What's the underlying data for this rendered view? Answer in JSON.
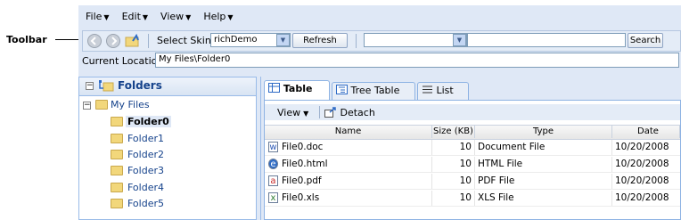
{
  "callout": {
    "label": "Toolbar"
  },
  "menu": [
    {
      "label": "File"
    },
    {
      "label": "Edit"
    },
    {
      "label": "View"
    },
    {
      "label": "Help"
    }
  ],
  "toolbar": {
    "select_skin_label": "Select Skin",
    "skin_value": "richDemo",
    "refresh_label": "Refresh",
    "search_combo_value": "",
    "search_value": "",
    "search_label": "Search"
  },
  "location": {
    "label": "Current Location:",
    "value": "My Files\\Folder0"
  },
  "tree": {
    "title": "Folders",
    "root": "My Files",
    "folders": [
      "Folder0",
      "Folder1",
      "Folder2",
      "Folder3",
      "Folder4",
      "Folder5"
    ],
    "selected": "Folder0"
  },
  "tabs": [
    {
      "label": "Table",
      "active": true
    },
    {
      "label": "Tree Table",
      "active": false
    },
    {
      "label": "List",
      "active": false
    }
  ],
  "grid_toolbar": {
    "view_label": "View",
    "detach_label": "Detach"
  },
  "table": {
    "columns": [
      "Name",
      "Size (KB)",
      "Type",
      "Date"
    ],
    "rows": [
      {
        "name": "File0.doc",
        "size": "10",
        "type": "Document File",
        "date": "10/20/2008",
        "icon": "word-doc-icon"
      },
      {
        "name": "File0.html",
        "size": "10",
        "type": "HTML File",
        "date": "10/20/2008",
        "icon": "html-file-icon"
      },
      {
        "name": "File0.pdf",
        "size": "10",
        "type": "PDF File",
        "date": "10/20/2008",
        "icon": "pdf-file-icon"
      },
      {
        "name": "File0.xls",
        "size": "10",
        "type": "XLS File",
        "date": "10/20/2008",
        "icon": "excel-file-icon"
      }
    ]
  },
  "colors": {
    "panel_bg": "#dfe8f6",
    "border": "#99bbe8",
    "header_text": "#15428b"
  }
}
